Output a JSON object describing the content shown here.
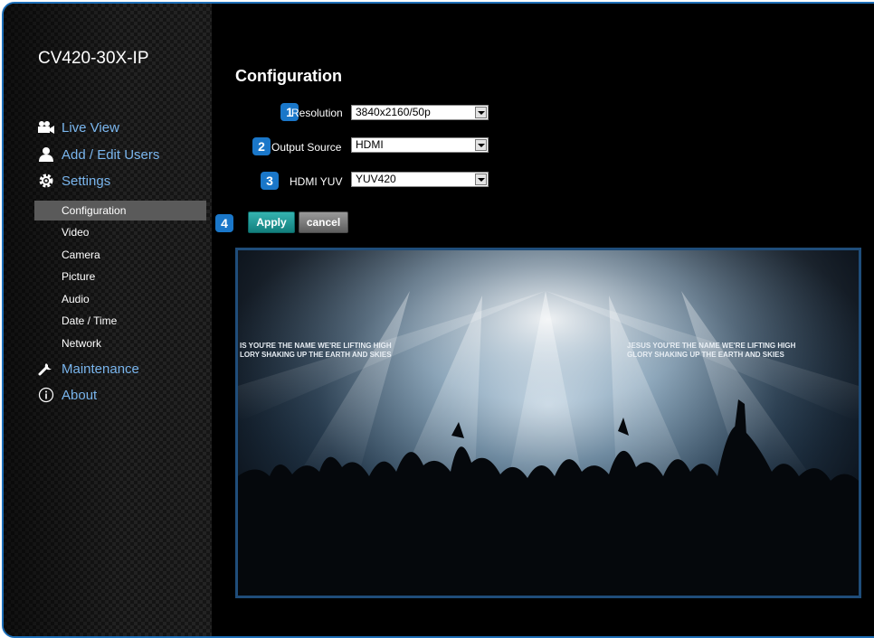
{
  "app": {
    "title": "CV420-30X-IP"
  },
  "nav": {
    "items": [
      {
        "label": "Live View",
        "icon": "video-camera-icon"
      },
      {
        "label": "Add / Edit Users",
        "icon": "user-icon"
      },
      {
        "label": "Settings",
        "icon": "gear-icon"
      }
    ],
    "settings_sub": [
      {
        "label": "Configuration",
        "active": true
      },
      {
        "label": "Video"
      },
      {
        "label": "Camera"
      },
      {
        "label": "Picture"
      },
      {
        "label": "Audio"
      },
      {
        "label": "Date / Time"
      },
      {
        "label": "Network"
      }
    ],
    "items_bottom": [
      {
        "label": "Maintenance",
        "icon": "wrench-icon"
      },
      {
        "label": "About",
        "icon": "info-icon"
      }
    ]
  },
  "main": {
    "title": "Configuration",
    "fields": [
      {
        "badge": "1",
        "label": "Resolution",
        "value": "3840x2160/50p"
      },
      {
        "badge": "2",
        "label": "Output Source",
        "value": "HDMI"
      },
      {
        "badge": "3",
        "label": "HDMI YUV",
        "value": "YUV420"
      }
    ],
    "actions": {
      "badge": "4",
      "apply": "Apply",
      "cancel": "cancel"
    }
  },
  "preview": {
    "lyric_left_1": "IS YOU'RE THE NAME WE'RE LIFTING HIGH",
    "lyric_left_2": "LORY SHAKING UP THE EARTH AND SKIES",
    "lyric_right_1": "JESUS YOU'RE THE NAME WE'RE LIFTING HIGH",
    "lyric_right_2": "GLORY SHAKING UP THE EARTH AND SKIES"
  },
  "colors": {
    "accent": "#1a77c9",
    "nav_link": "#7ab6ee",
    "apply": "#1e9996",
    "frame_border": "#1e6fb8"
  }
}
